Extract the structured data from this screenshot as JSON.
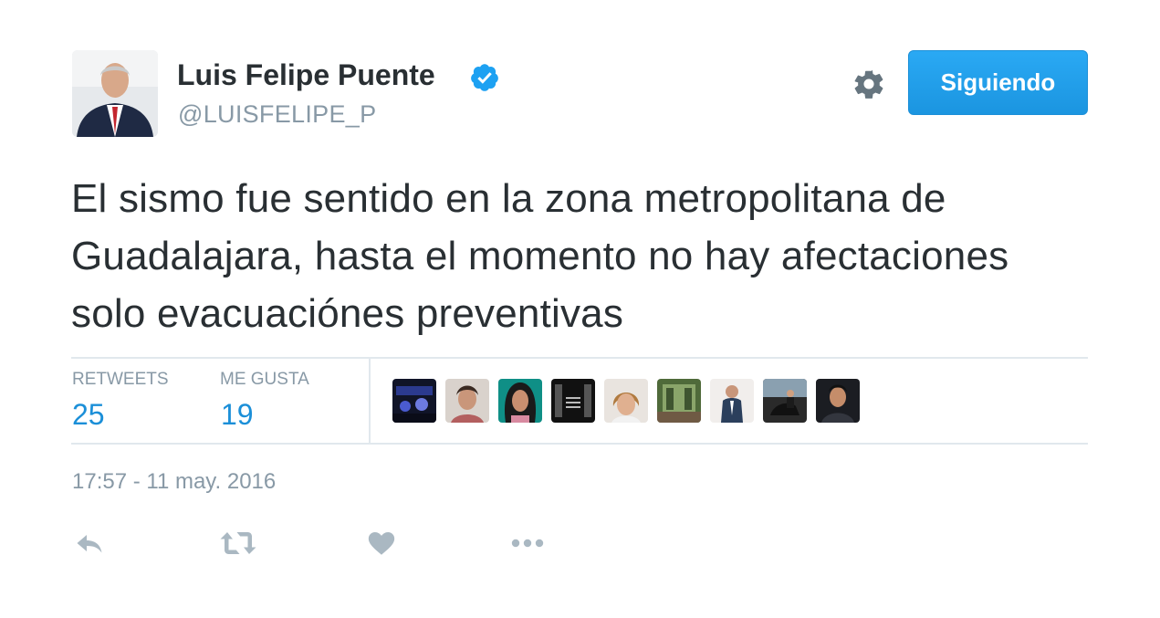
{
  "author": {
    "name": "Luis Felipe Puente",
    "handle": "@LUISFELIPE_P"
  },
  "header": {
    "follow_label": "Siguiendo"
  },
  "tweet": {
    "text": "El sismo fue sentido en la zona metropolitana de Guadalajara, hasta el momento no hay afectaciones solo evacuaciónes preventivas",
    "timestamp": "17:57 - 11 may. 2016"
  },
  "stats": {
    "retweets_label": "RETWEETS",
    "retweets_count": "25",
    "likes_label": "ME GUSTA",
    "likes_count": "19"
  },
  "likers_avatars": [
    {
      "name": "liker-avatar-1"
    },
    {
      "name": "liker-avatar-2"
    },
    {
      "name": "liker-avatar-3"
    },
    {
      "name": "liker-avatar-4"
    },
    {
      "name": "liker-avatar-5"
    },
    {
      "name": "liker-avatar-6"
    },
    {
      "name": "liker-avatar-7"
    },
    {
      "name": "liker-avatar-8"
    },
    {
      "name": "liker-avatar-9"
    }
  ],
  "icons": {
    "verified": "verified-badge-icon",
    "settings": "gear-icon",
    "reply": "reply-icon",
    "retweet": "retweet-icon",
    "like": "heart-icon",
    "more": "more-icon"
  },
  "colors": {
    "accent": "#1da1f2",
    "text": "#292f33",
    "muted": "#8899a6",
    "stat_value": "#1b8fd8"
  }
}
